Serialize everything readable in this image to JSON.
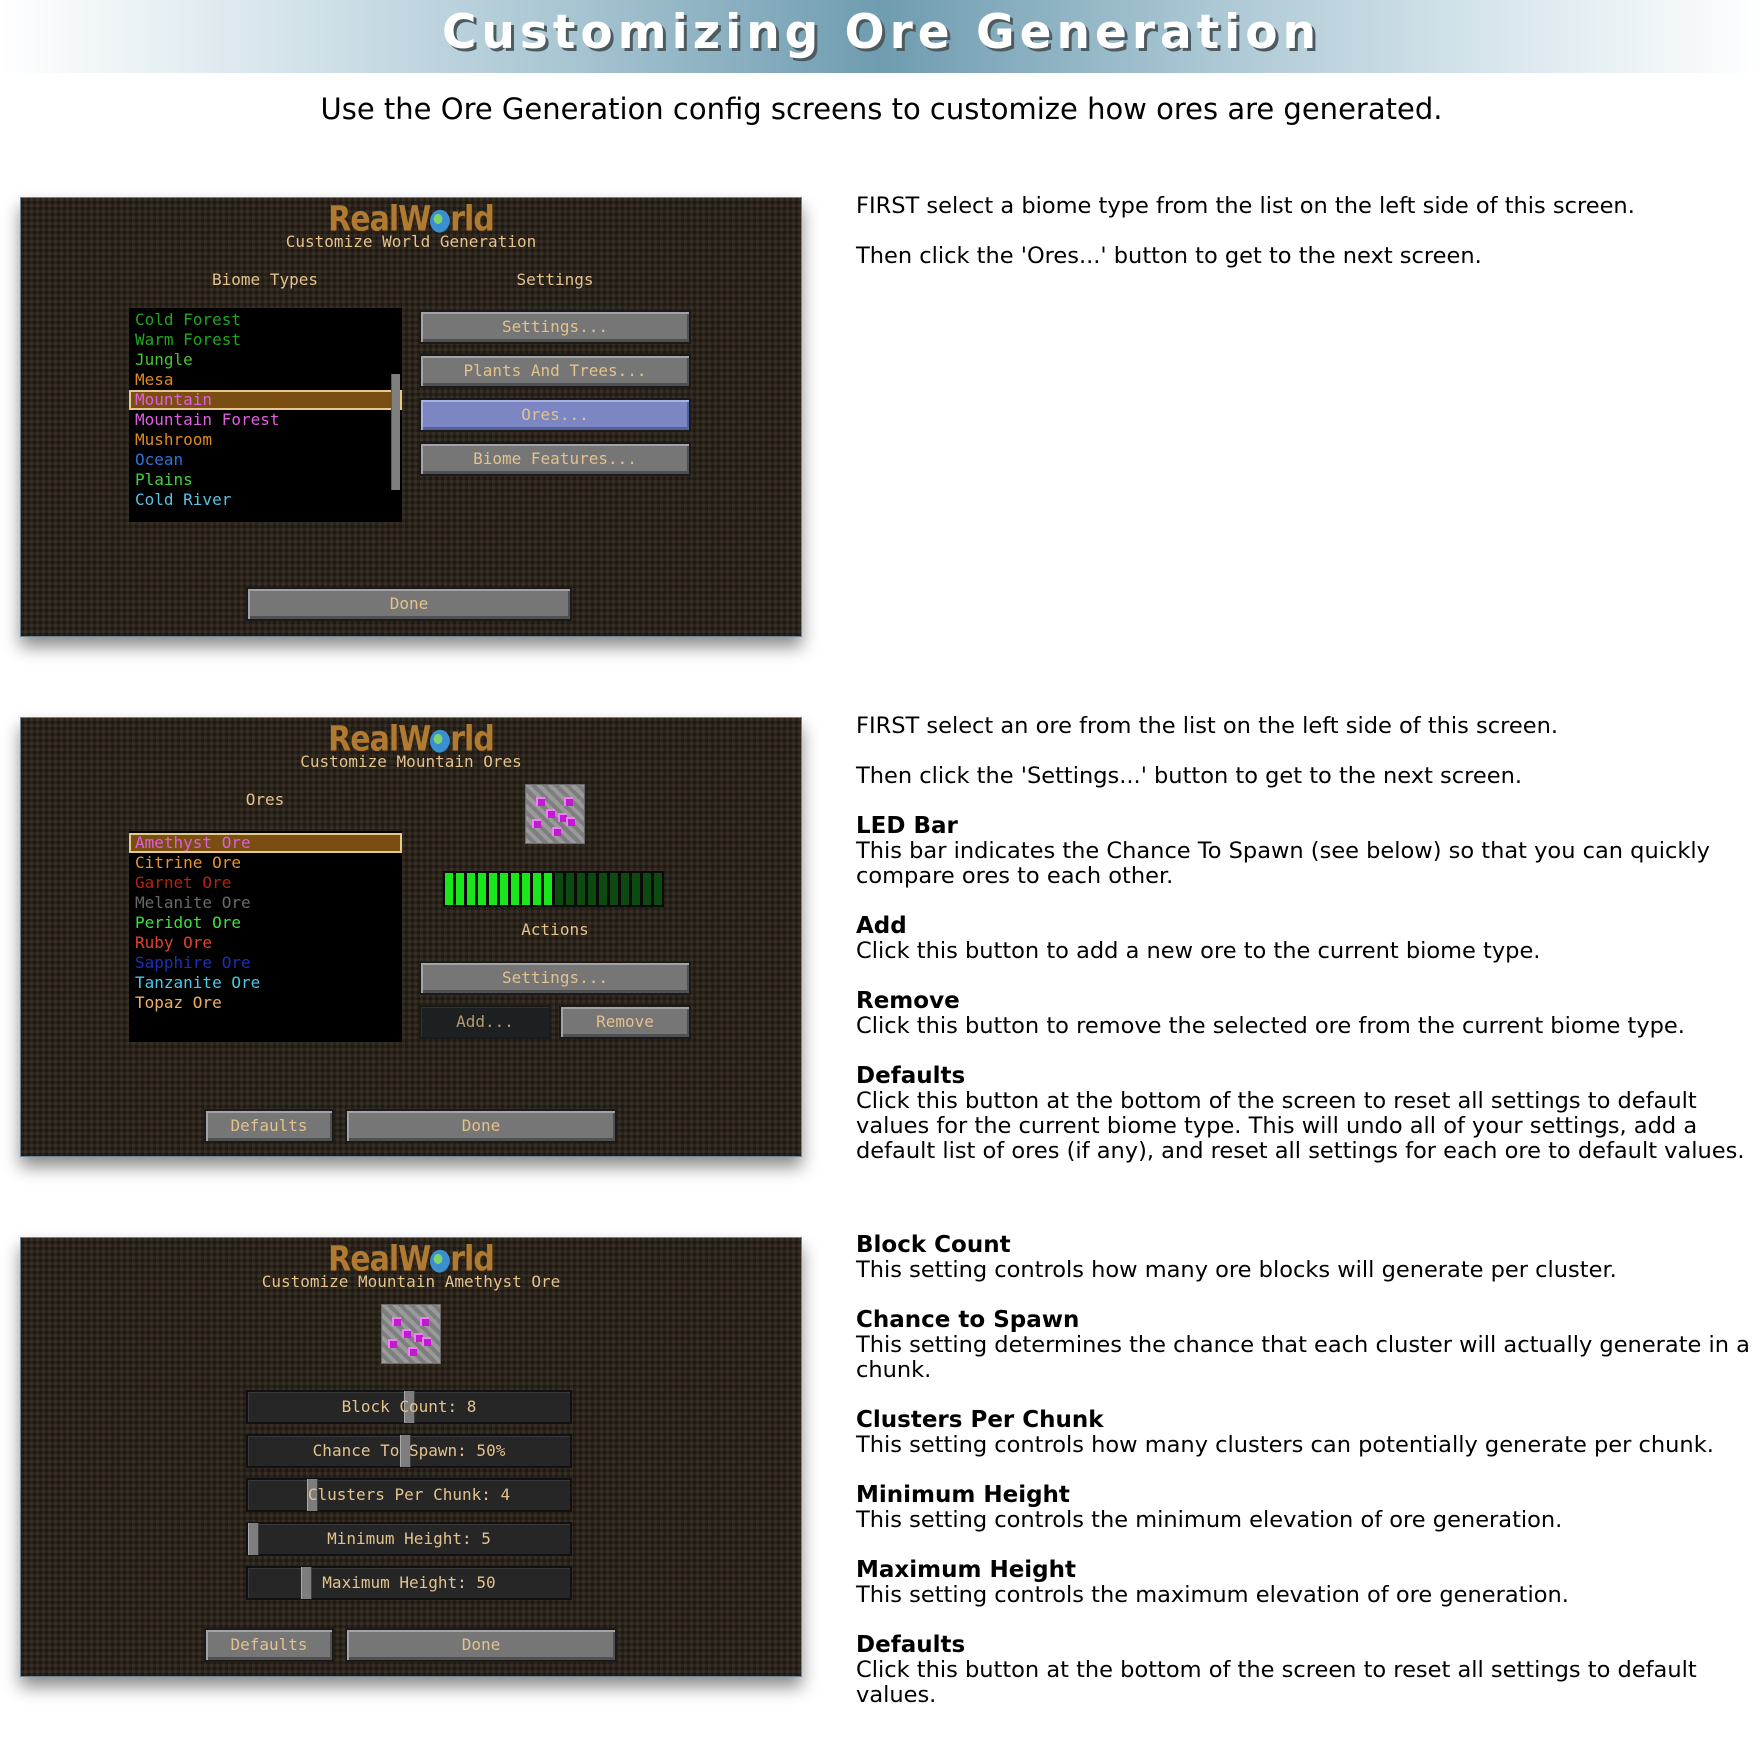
{
  "header": {
    "title": "Customizing Ore Generation",
    "subtitle": "Use the Ore Generation config screens to customize how ores are generated."
  },
  "app": {
    "logo_left": "RealW",
    "logo_right": "rld",
    "logo_icon": "globe-icon"
  },
  "screen1": {
    "title": "Customize World Generation",
    "list_label": "Biome Types",
    "settings_label": "Settings",
    "biomes": [
      {
        "label": "Cold Forest",
        "color": "#1fa81f"
      },
      {
        "label": "Warm Forest",
        "color": "#1fa81f"
      },
      {
        "label": "Jungle",
        "color": "#44c92d"
      },
      {
        "label": "Mesa",
        "color": "#e08a1e"
      },
      {
        "label": "Mountain",
        "color": "#e05ee0",
        "selected": true
      },
      {
        "label": "Mountain Forest",
        "color": "#e05ee0"
      },
      {
        "label": "Mushroom",
        "color": "#e08a1e"
      },
      {
        "label": "Ocean",
        "color": "#2f72d8"
      },
      {
        "label": "Plains",
        "color": "#3fd43f"
      },
      {
        "label": "Cold River",
        "color": "#5bc0e6"
      }
    ],
    "buttons": {
      "settings": "Settings...",
      "plants": "Plants And Trees...",
      "ores": "Ores...",
      "features": "Biome Features...",
      "done": "Done"
    }
  },
  "screen2": {
    "title": "Customize Mountain Ores",
    "list_label": "Ores",
    "actions_label": "Actions",
    "ores": [
      {
        "label": "Amethyst Ore",
        "color": "#e05ee0",
        "selected": true
      },
      {
        "label": "Citrine Ore",
        "color": "#e8952a"
      },
      {
        "label": "Garnet Ore",
        "color": "#b52410"
      },
      {
        "label": "Melanite Ore",
        "color": "#6a6a6a"
      },
      {
        "label": "Peridot Ore",
        "color": "#3fe03f"
      },
      {
        "label": "Ruby Ore",
        "color": "#e0442a"
      },
      {
        "label": "Sapphire Ore",
        "color": "#1c30b8"
      },
      {
        "label": "Tanzanite Ore",
        "color": "#4ec8e8"
      },
      {
        "label": "Topaz Ore",
        "color": "#f0b060"
      }
    ],
    "led_bar": {
      "lit": 10,
      "total": 20,
      "chance_percent": 50
    },
    "buttons": {
      "settings": "Settings...",
      "add": "Add...",
      "remove": "Remove",
      "defaults": "Defaults",
      "done": "Done"
    }
  },
  "screen3": {
    "title": "Customize Mountain Amethyst Ore",
    "sliders": [
      {
        "label": "Block Count: 8",
        "position": 0.5
      },
      {
        "label": "Chance To Spawn: 50%",
        "position": 0.49
      },
      {
        "label": "Clusters Per Chunk: 4",
        "position": 0.19
      },
      {
        "label": "Minimum Height: 5",
        "position": 0.0
      },
      {
        "label": "Maximum Height: 50",
        "position": 0.17
      }
    ],
    "buttons": {
      "defaults": "Defaults",
      "done": "Done"
    }
  },
  "descriptions": {
    "section1": [
      "FIRST select a biome type from the list on the left side of this screen.",
      "Then click the 'Ores...' button to get to the next screen."
    ],
    "section2_intro": [
      "FIRST select an ore from the list on the left side of this screen.",
      "Then click the 'Settings...' button to get to the next screen."
    ],
    "section2_items": [
      {
        "heading": "LED Bar",
        "text": "This bar indicates the Chance To Spawn (see below) so that you can quickly compare ores to each other."
      },
      {
        "heading": "Add",
        "text": "Click this button to add a new ore to the current biome type."
      },
      {
        "heading": "Remove",
        "text": "Click this button to remove the selected ore from the current biome type."
      },
      {
        "heading": "Defaults",
        "text": "Click this button at the bottom of the screen to reset all settings to default values for the current biome type. This will undo all of your settings, add a default list of ores (if any), and reset all settings for each ore to default values."
      }
    ],
    "section3_items": [
      {
        "heading": "Block Count",
        "text": "This setting controls how many ore blocks will generate per cluster."
      },
      {
        "heading": "Chance to Spawn",
        "text": "This setting determines the chance that each cluster will actually generate in a chunk."
      },
      {
        "heading": "Clusters Per Chunk",
        "text": "This setting controls how many clusters can potentially generate per chunk."
      },
      {
        "heading": "Minimum Height",
        "text": "This setting controls the minimum elevation of ore generation."
      },
      {
        "heading": "Maximum Height",
        "text": "This setting controls the maximum elevation of ore generation."
      },
      {
        "heading": "Defaults",
        "text": "Click this button at the bottom of the screen to reset all settings to default values."
      }
    ]
  }
}
